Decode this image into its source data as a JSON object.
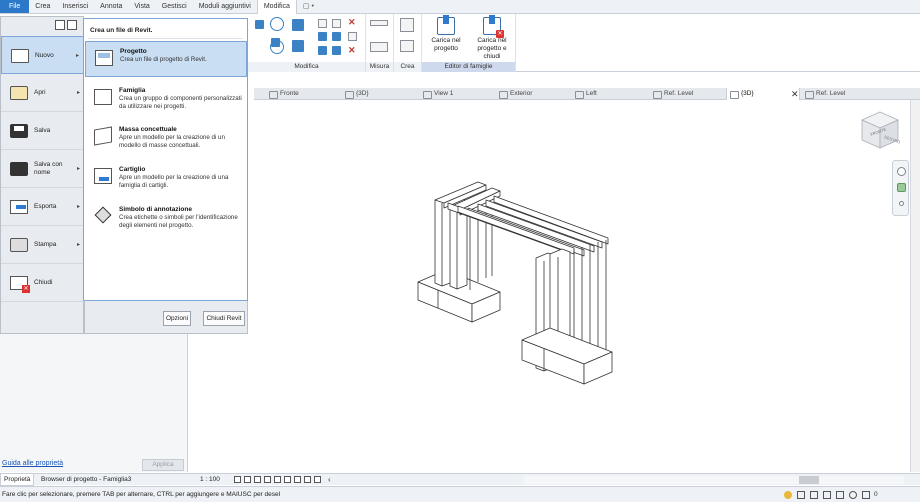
{
  "ribbon": {
    "tabs": [
      {
        "label": "File",
        "kind": "file"
      },
      {
        "label": "Crea",
        "kind": ""
      },
      {
        "label": "Inserisci",
        "kind": ""
      },
      {
        "label": "Annota",
        "kind": ""
      },
      {
        "label": "Vista",
        "kind": ""
      },
      {
        "label": "Gestisci",
        "kind": ""
      },
      {
        "label": "Moduli aggiuntivi",
        "kind": ""
      },
      {
        "label": "Modifica",
        "kind": "active"
      },
      {
        "label": "▢ •",
        "kind": "extra"
      }
    ],
    "panels": {
      "modifica": "Modifica",
      "misura": "Misura",
      "crea": "Crea",
      "editor": "Editor di famiglie"
    },
    "load_project": "Carica nel progetto",
    "load_close": "Carica nel progetto e chiudi"
  },
  "file_menu": {
    "items": [
      {
        "label": "Nuovo",
        "icon": "new-document-icon",
        "arrow": "▸",
        "selected": true
      },
      {
        "label": "Apri",
        "icon": "open-folder-icon",
        "arrow": "▸",
        "selected": false
      },
      {
        "label": "Salva",
        "icon": "save-disk-icon",
        "arrow": "",
        "selected": false
      },
      {
        "label": "Salva con nome",
        "icon": "save-as-icon",
        "arrow": "▸",
        "selected": false
      },
      {
        "label": "Esporta",
        "icon": "export-icon",
        "arrow": "▸",
        "selected": false
      },
      {
        "label": "Stampa",
        "icon": "printer-icon",
        "arrow": "▸",
        "selected": false
      },
      {
        "label": "Chiudi",
        "icon": "close-document-icon",
        "arrow": "",
        "selected": false
      }
    ],
    "submenu_title": "Crea un file di Revit.",
    "submenu": [
      {
        "title": "Progetto",
        "desc": "Crea un file di progetto di Revit.",
        "icon": "project-file-icon",
        "selected": true
      },
      {
        "title": "Famiglia",
        "desc": "Crea un gruppo di componenti personalizzati da utilizzare nei progetti.",
        "icon": "family-file-icon",
        "selected": false
      },
      {
        "title": "Massa concettuale",
        "desc": "Apre un modello per la creazione di un modello di masse concettuali.",
        "icon": "conceptual-mass-icon",
        "selected": false
      },
      {
        "title": "Cartiglio",
        "desc": "Apre un modello per la creazione di una famiglia di cartigli.",
        "icon": "title-block-icon",
        "selected": false
      },
      {
        "title": "Simbolo di annotazione",
        "desc": "Crea etichette o simboli per l'identificazione degli elementi nel progetto.",
        "icon": "annotation-symbol-icon",
        "selected": false
      }
    ],
    "options_button": "Opzioni",
    "exit_button": "Chiudi Revit"
  },
  "view_tabs": [
    {
      "label": "Fronte",
      "active": false
    },
    {
      "label": "{3D}",
      "active": false
    },
    {
      "label": "View 1",
      "active": false
    },
    {
      "label": "Exterior",
      "active": false
    },
    {
      "label": "Left",
      "active": false
    },
    {
      "label": "Ref. Level",
      "active": false
    },
    {
      "label": "{3D}",
      "active": true
    },
    {
      "label": "Ref. Level",
      "active": false
    }
  ],
  "view_tab_close": "✕",
  "viewcube_labels": {
    "front": "FRONTE",
    "right": "DESTRO"
  },
  "properties": {
    "help_link": "Guida alle proprietà",
    "apply_button": "Applica",
    "tabs": [
      "Proprietà",
      "Browser di progetto - Famiglia3"
    ]
  },
  "view_control": {
    "scale": "1 : 100",
    "scroll_left": "‹"
  },
  "status": {
    "text": "Fare clic per selezionare, premere TAB per alternare, CTRL per aggiungere e MAIUSC per desel",
    "filter_count": "0"
  },
  "colors": {
    "accent": "#2b79c8",
    "selection": "#c9ddf3",
    "editor_panel": "#cfd9ee"
  }
}
